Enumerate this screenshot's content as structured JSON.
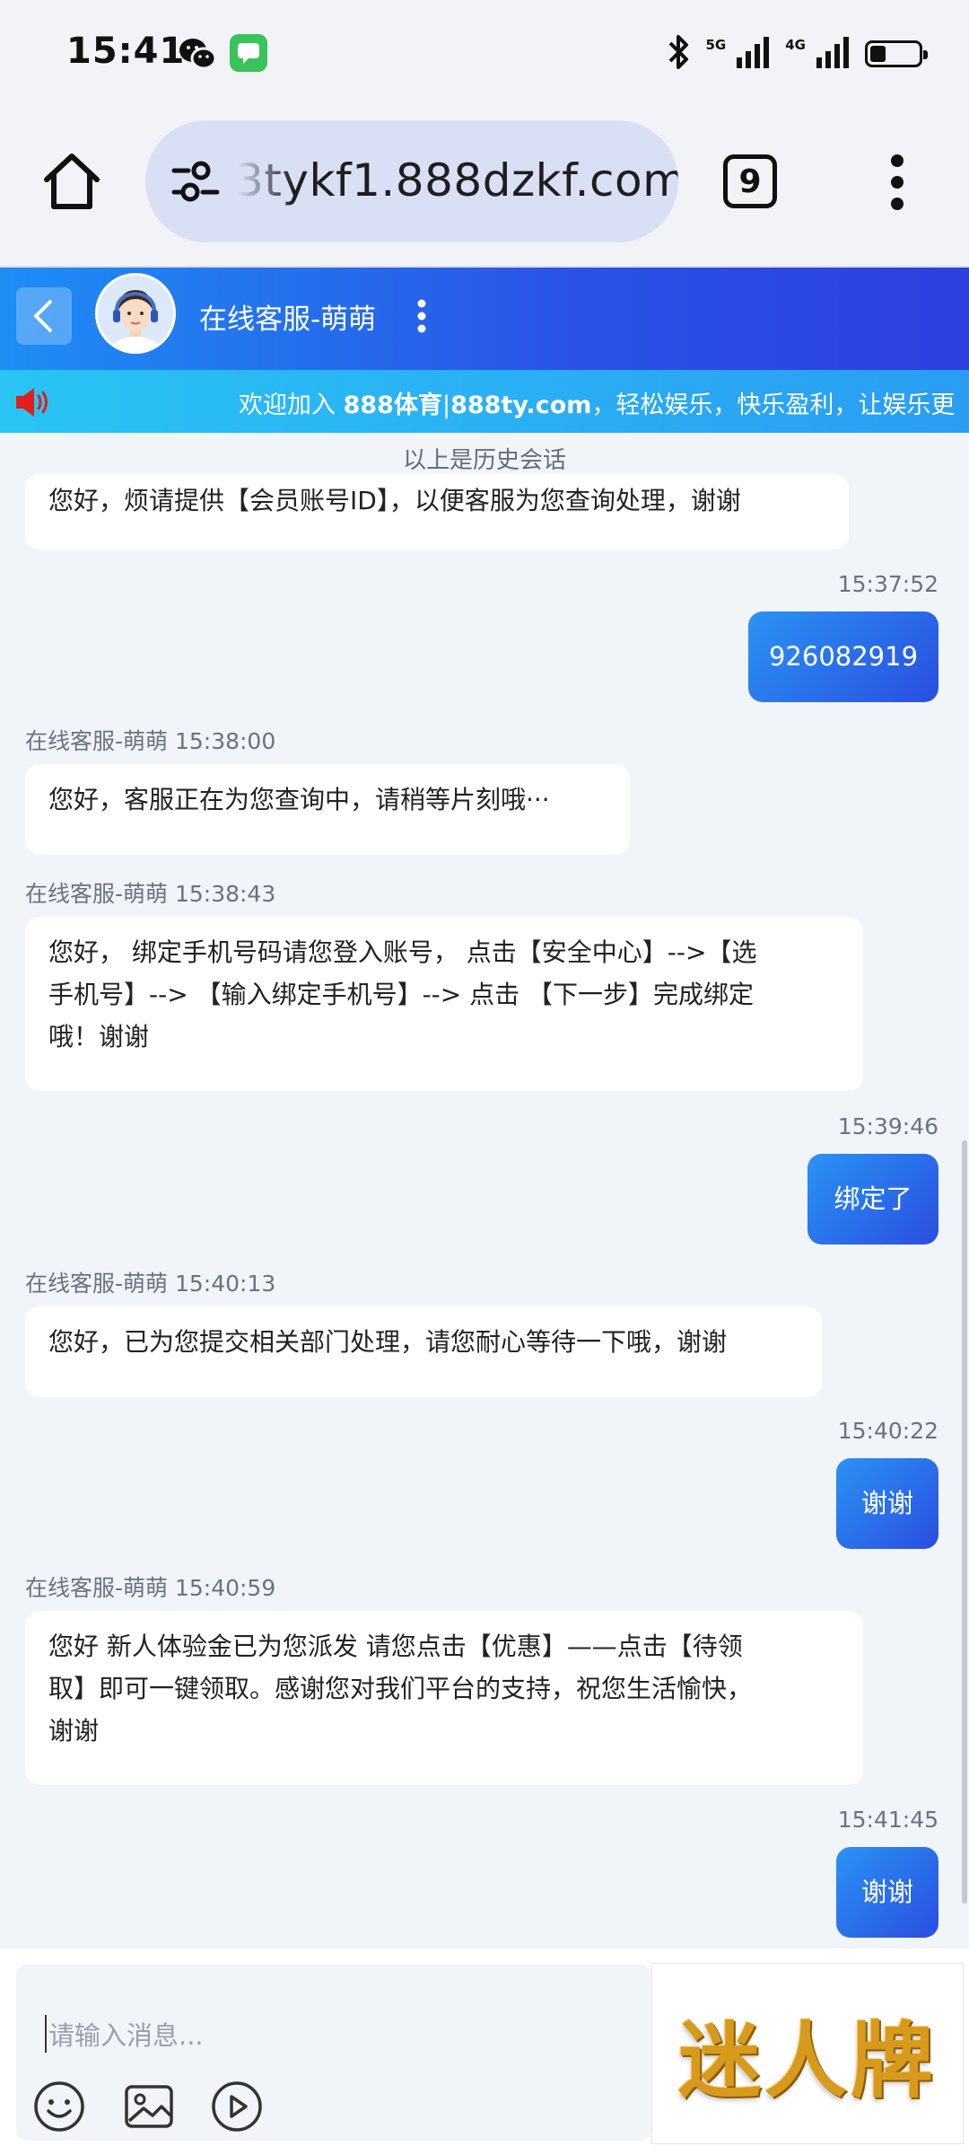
{
  "status_bar": {
    "time": "15:41",
    "net_5g": "5G",
    "net_4g": "4G",
    "battery_level": 0.3
  },
  "browser": {
    "url": "3tykf1.888dzkf.com",
    "tab_count": "9"
  },
  "chat_header": {
    "agent_name": "在线客服-萌萌"
  },
  "marquee": {
    "prefix": "欢迎加入 ",
    "brand": "888体育",
    "separator": "|",
    "site": "888ty.com",
    "suffix": "，轻松娱乐，快乐盈利，让娱乐更"
  },
  "history_note": "以上是历史会话",
  "messages": [
    {
      "from": "agent",
      "meta": "",
      "text": "您好，烦请提供【会员账号ID】，以便客服为您查询处理，谢谢"
    },
    {
      "from": "user",
      "meta": "15:37:52",
      "text": "926082919"
    },
    {
      "from": "agent",
      "meta": "在线客服-萌萌 15:38:00",
      "text": "您好，客服正在为您查询中，请稍等片刻哦···"
    },
    {
      "from": "agent",
      "meta": "在线客服-萌萌 15:38:43",
      "lines": [
        "您好， 绑定手机号码请您登入账号， 点击【安全中心】-->【选",
        "手机号】--> 【输入绑定手机号】--> 点击 【下一步】完成绑定",
        "哦！谢谢"
      ]
    },
    {
      "from": "user",
      "meta": "15:39:46",
      "text": "绑定了"
    },
    {
      "from": "agent",
      "meta": "在线客服-萌萌 15:40:13",
      "text": "您好，已为您提交相关部门处理，请您耐心等待一下哦，谢谢"
    },
    {
      "from": "user",
      "meta": "15:40:22",
      "text": "谢谢"
    },
    {
      "from": "agent",
      "meta": "在线客服-萌萌 15:40:59",
      "lines": [
        "您好 新人体验金已为您派发 请您点击【优惠】——点击【待领",
        "取】即可一键领取。感谢您对我们平台的支持，祝您生活愉快，",
        "谢谢"
      ]
    },
    {
      "from": "user",
      "meta": "15:41:45",
      "text": "谢谢"
    }
  ],
  "input": {
    "placeholder": "请输入消息..."
  },
  "watermark": {
    "text": "迷人牌"
  },
  "colors": {
    "header_gradient_start": "#1e8ef5",
    "header_gradient_end": "#2c3fe0",
    "marquee_bg": "#29b2f4",
    "user_bubble": "#2a6ff0",
    "chat_bg": "#f1f4f9"
  }
}
